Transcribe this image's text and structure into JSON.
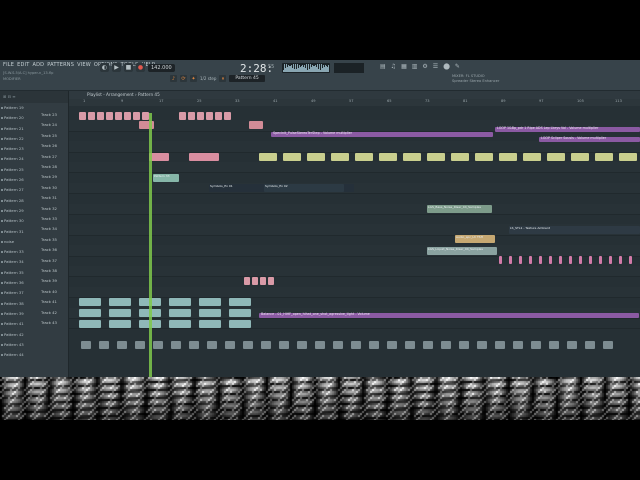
{
  "menu": [
    "FILE",
    "EDIT",
    "ADD",
    "PATTERNS",
    "VIEW",
    "OPTIONS",
    "TOOLS",
    "HELP"
  ],
  "hint": "[S.W.S.5/A.C] hyper-n_13.flp",
  "hint2": "MODIFIER",
  "tempo": "142.000",
  "clock": "2:28:",
  "clock_ms": "55",
  "pattern": "Pattern 45",
  "step": "1/2 step",
  "playlist_title": "Playlist - Arrangement › Pattern 45",
  "mixer_info": [
    "MIXER: FL STUDIO",
    "Spreader Stereo Enhancer"
  ],
  "track_header": "Track 34",
  "ruler": [
    "1",
    "9",
    "17",
    "25",
    "33",
    "41",
    "49",
    "57",
    "65",
    "73",
    "81",
    "89",
    "97",
    "105",
    "113",
    "121"
  ],
  "browser_items": [
    "Pattern 19",
    "Pattern 20",
    "Pattern 21",
    "Pattern 22",
    "Pattern 23",
    "Pattern 24",
    "Pattern 25",
    "Pattern 26",
    "Pattern 27",
    "Pattern 28",
    "Pattern 29",
    "Pattern 30",
    "Pattern 31",
    "noise",
    "Pattern 33",
    "Pattern 34",
    "Pattern 35",
    "Pattern 36",
    "Pattern 37",
    "Pattern 38",
    "Pattern 39",
    "Pattern 41",
    "Pattern 42",
    "Pattern 43",
    "Pattern 44"
  ],
  "tracks": [
    "Track 23",
    "Track 24",
    "Track 25",
    "Track 26",
    "Track 27",
    "Track 28",
    "Track 29",
    "Track 30",
    "Track 31",
    "Track 32",
    "Track 33",
    "Track 34",
    "Track 35",
    "Track 36",
    "Track 37",
    "Track 38",
    "Track 39",
    "Track 40",
    "Track 41",
    "Track 42",
    "Track 43"
  ],
  "automations": [
    {
      "label": "Specinit_PulseStereoTerStep - Volume multiplier"
    },
    {
      "label": "LGOP 1&Bp_pdr 1 Ripe ADS Lep Lkeys Vol - Volume multiplier"
    },
    {
      "label": "LGOP Scliper Sousls - Volume multiplier"
    },
    {
      "label": "Balance - 01_HiHF_open_hihat_one_shot_agressive_tight - Volume"
    }
  ],
  "clip_labels": [
    "Symbols_Ex 01",
    "Symbols_Ex 02",
    "Pattern 33",
    "LGS_Bass_Noise_Riser_04_Samples",
    "LGS_Liquid_Noise_Riser_04_Samples",
    "LS_STL1 - Texture Ambient",
    "LOFF Spe_Afl",
    "audio_spc_Lh TSH"
  ]
}
